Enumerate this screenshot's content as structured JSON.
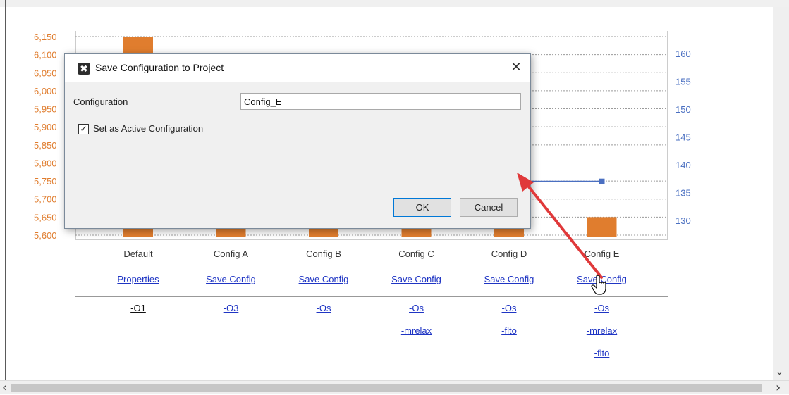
{
  "colors": {
    "bar_orange": "#e07d2e",
    "line_blue": "#4a6fc1",
    "link_blue": "#1f35c4",
    "annotation_red": "#e0393a",
    "dialog_bg": "#f0f0f0"
  },
  "chart_data": {
    "type": "bar",
    "categories": [
      "Default",
      "Config A",
      "Config B",
      "Config C",
      "Config D",
      "Config E"
    ],
    "series": [
      {
        "axis": "left",
        "type": "bar",
        "values": [
          6150,
          null,
          null,
          null,
          null,
          5650
        ]
      },
      {
        "axis": "right",
        "type": "line",
        "values": [
          null,
          null,
          null,
          null,
          137,
          137
        ]
      }
    ],
    "y_left": {
      "ticks": [
        "6,150",
        "6,100",
        "6,050",
        "6,000",
        "5,950",
        "5,900",
        "5,850",
        "5,800",
        "5,750",
        "5,700",
        "5,650",
        "5,600"
      ],
      "ylim": [
        5600,
        6150
      ]
    },
    "y_right": {
      "ticks": [
        "160",
        "155",
        "150",
        "145",
        "140",
        "135",
        "130"
      ],
      "ylim": [
        126.5,
        161.5
      ]
    },
    "grid": true,
    "grid_style": "dashed"
  },
  "config_links": [
    "Properties",
    "Save Config",
    "Save Config",
    "Save Config",
    "Save Config",
    "Save Config"
  ],
  "flags": [
    [
      "-O1"
    ],
    [
      "-O3"
    ],
    [
      "-Os"
    ],
    [
      "-Os",
      "-mrelax"
    ],
    [
      "-Os",
      "-flto"
    ],
    [
      "-Os",
      "-mrelax",
      "-flto"
    ]
  ],
  "dialog": {
    "title": "Save Configuration to Project",
    "app_icon": "x-logo-icon",
    "close_glyph": "✕",
    "config_label": "Configuration",
    "config_value": "Config_E",
    "checkbox_label": "Set as Active Configuration",
    "checkbox_checked": true,
    "check_glyph": "✓",
    "ok_label": "OK",
    "cancel_label": "Cancel"
  },
  "scrollbar": {
    "left_arrow": "‹",
    "right_arrow": "›",
    "down_arrow": "⌄"
  },
  "cursor": "hand-pointer-icon"
}
